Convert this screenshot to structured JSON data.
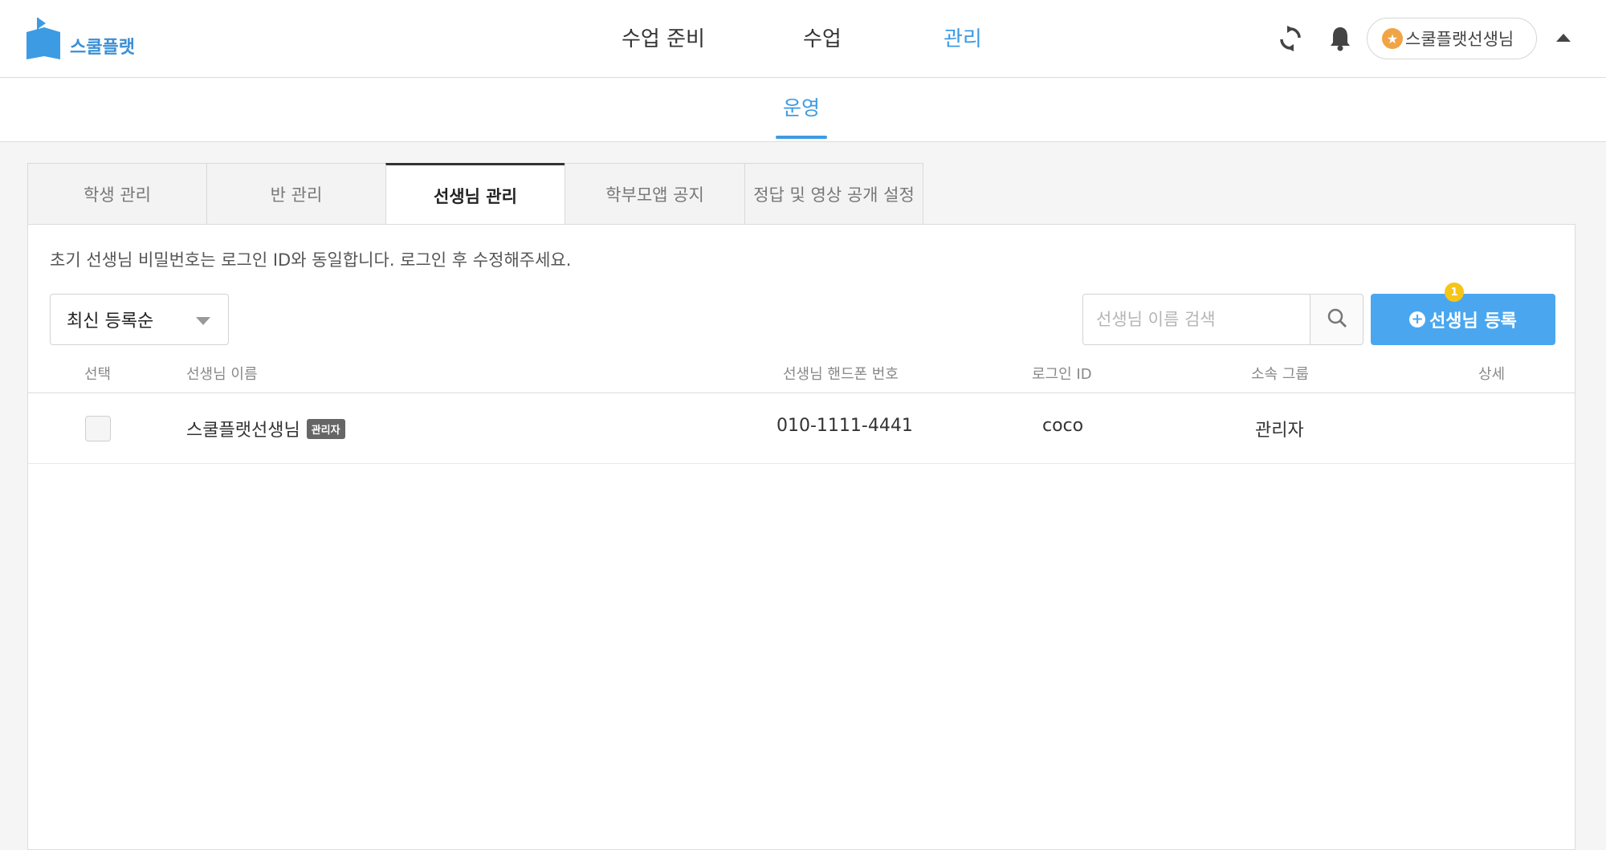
{
  "header": {
    "logo_text": "스쿨플랫",
    "nav": [
      "수업 준비",
      "수업",
      "관리"
    ],
    "active_nav": "관리",
    "user_name": "스쿨플랫선생님",
    "accent": "#3d9be3"
  },
  "subnav": {
    "label": "운영"
  },
  "tabs": [
    "학생 관리",
    "반 관리",
    "선생님 관리",
    "학부모앱 공지",
    "정답 및 영상 공개 설정"
  ],
  "active_tab": "선생님 관리",
  "panel": {
    "notice": "초기 선생님 비밀번호는 로그인 ID와 동일합니다. 로그인 후 수정해주세요.",
    "sort_value": "최신 등록순",
    "search_placeholder": "선생님 이름 검색",
    "register_label": "선생님 등록",
    "register_badge": "1"
  },
  "table": {
    "headers": [
      "선택",
      "선생님 이름",
      "선생님 핸드폰 번호",
      "로그인 ID",
      "소속 그룹",
      "상세"
    ],
    "rows": [
      {
        "name": "스쿨플랫선생님",
        "role_tag": "관리자",
        "phone": "010-1111-4441",
        "login_id": "coco",
        "group": "관리자"
      }
    ]
  },
  "icons": {
    "refresh": "refresh-icon",
    "bell": "bell-icon",
    "star": "star-icon",
    "search": "search-icon",
    "plus": "plus-circle-icon"
  }
}
